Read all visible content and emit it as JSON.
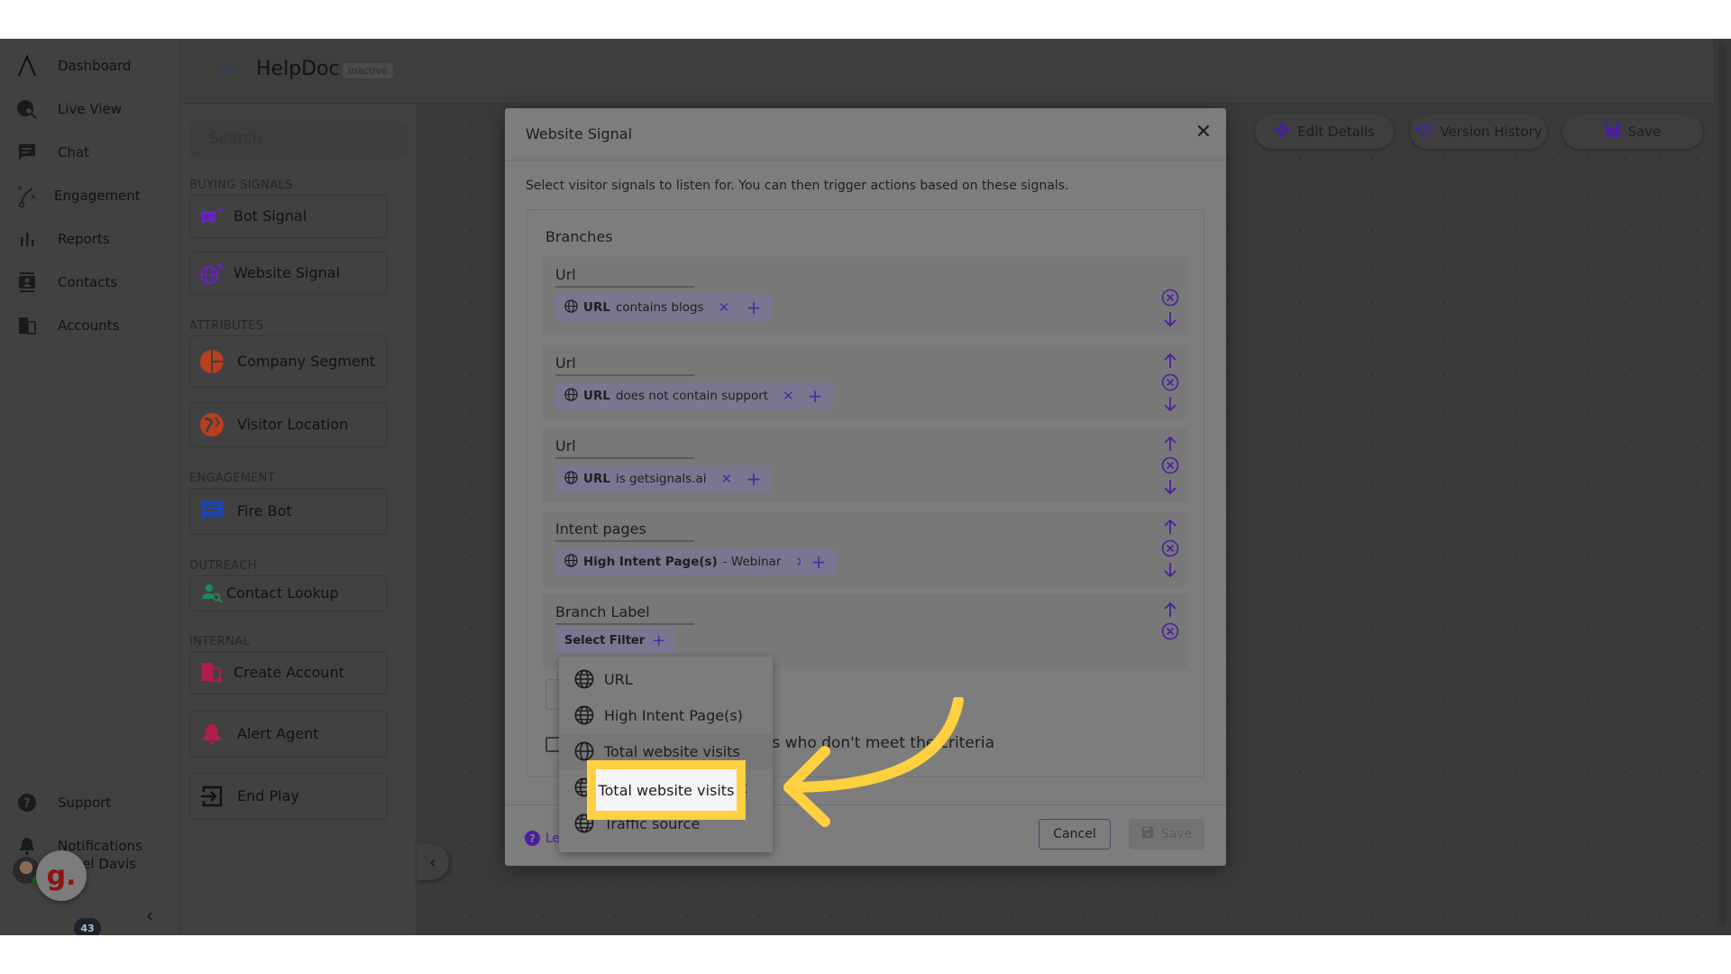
{
  "app": {
    "nav": [
      {
        "label": "Dashboard",
        "icon": "logo-icon"
      },
      {
        "label": "Live View",
        "icon": "live-view-icon"
      },
      {
        "label": "Chat",
        "icon": "chat-icon"
      },
      {
        "label": "Engagement",
        "icon": "engagement-icon"
      },
      {
        "label": "Reports",
        "icon": "reports-icon"
      },
      {
        "label": "Contacts",
        "icon": "contacts-icon"
      },
      {
        "label": "Accounts",
        "icon": "accounts-icon"
      }
    ],
    "nav_bottom": [
      {
        "label": "Support",
        "icon": "help-icon"
      },
      {
        "label": "Notifications",
        "icon": "bell-icon"
      }
    ],
    "user": {
      "name": "Michael Davis",
      "visible_name": "ael Davis"
    },
    "widget": {
      "letter": "g.",
      "badge": "43"
    }
  },
  "header": {
    "title": "HelpDoc",
    "status": "Inactive"
  },
  "palette": {
    "search_placeholder": "Search",
    "sections": [
      {
        "title": "BUYING SIGNALS",
        "nodes": [
          {
            "label": "Bot Signal",
            "color": "#6a22c8"
          },
          {
            "label": "Website Signal",
            "color": "#6a22c8"
          }
        ]
      },
      {
        "title": "ATTRIBUTES",
        "nodes": [
          {
            "label": "Company Segment",
            "color": "#b8401e"
          },
          {
            "label": "Visitor Location",
            "color": "#b8401e"
          }
        ]
      },
      {
        "title": "ENGAGEMENT",
        "nodes": [
          {
            "label": "Fire Bot",
            "color": "#1e46b0"
          }
        ]
      },
      {
        "title": "OUTREACH",
        "nodes": [
          {
            "label": "Contact Lookup",
            "color": "#1e8a5a"
          }
        ]
      },
      {
        "title": "INTERNAL",
        "nodes": [
          {
            "label": "Create Account",
            "color": "#b01e4a"
          },
          {
            "label": "Alert Agent",
            "color": "#b01e4a"
          },
          {
            "label": "End Play",
            "color": "#111111"
          }
        ]
      }
    ]
  },
  "toolbar": {
    "edit_details": "Edit Details",
    "version_history": "Version History",
    "save": "Save"
  },
  "modal": {
    "title": "Website Signal",
    "description": "Select visitor signals to listen for. You can then trigger actions based on these signals.",
    "branches_title": "Branches",
    "branches": [
      {
        "label": "Url",
        "filter_field": "URL",
        "filter_rest": "contains blogs"
      },
      {
        "label": "Url",
        "filter_field": "URL",
        "filter_rest": "does not contain support"
      },
      {
        "label": "Url",
        "filter_field": "URL",
        "filter_rest": "is getsignals.ai"
      },
      {
        "label": "Intent pages",
        "filter_field": "High Intent Page(s)",
        "filter_rest": "- Webinar"
      },
      {
        "label": "Branch Label",
        "select_filter": "Select Filter"
      }
    ],
    "checkbox_label": "Create a branch for visitors who don't meet the criteria",
    "checkbox_checked": false,
    "learn_more": "Learn more",
    "cancel": "Cancel",
    "save": "Save"
  },
  "dropdown": {
    "items": [
      "URL",
      "High Intent Page(s)",
      "Total website visits",
      "Days since last visit",
      "Traffic source"
    ],
    "highlighted": "Total website visits"
  },
  "colors": {
    "accent": "#4a1ea0",
    "annotation": "#ffd140"
  }
}
